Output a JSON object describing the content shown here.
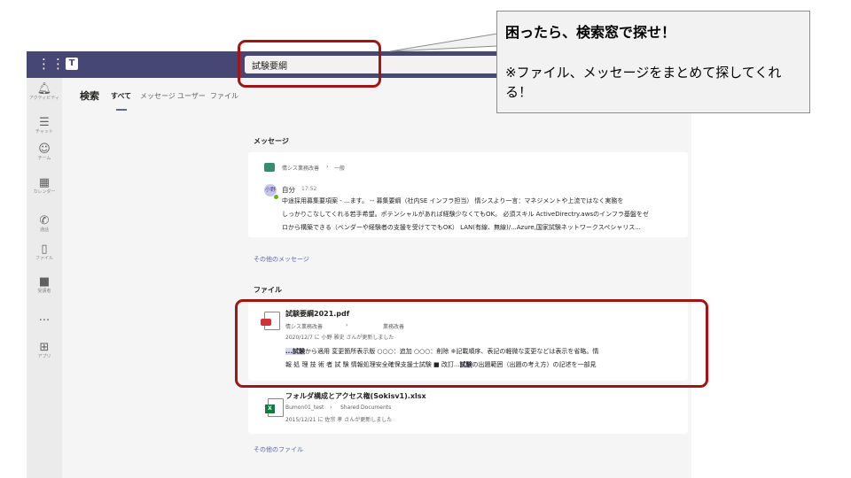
{
  "header": {
    "search_value": "試験要綱"
  },
  "rail": {
    "items": [
      {
        "label": "アクティビティ",
        "icon": "bell-icon"
      },
      {
        "label": "チャット",
        "icon": "chat-icon"
      },
      {
        "label": "チーム",
        "icon": "teams-icon"
      },
      {
        "label": "カレンダー",
        "icon": "calendar-icon"
      },
      {
        "label": "通話",
        "icon": "phone-icon"
      },
      {
        "label": "ファイル",
        "icon": "file-icon"
      },
      {
        "label": "受講者",
        "icon": "app-icon"
      },
      {
        "label": "アプリ",
        "icon": "apps-icon"
      }
    ],
    "more": "..."
  },
  "search_panel": {
    "title": "検索",
    "tabs": [
      "すべて",
      "メッセージ",
      "ユーザー",
      "ファイル"
    ]
  },
  "messages": {
    "section_title": "メッセージ",
    "channel": "情シス業務改善",
    "breadcrumb_sep": "›",
    "channel_sub": "一般",
    "avatar_initials": "小野",
    "sender": "自分",
    "time": "17:52",
    "lines": [
      "中途採用募集要項案 - ...ます。 -- 募集要綱（社内SE インフラ担当） 情シスより一言：マネジメントや上流ではなく実務を",
      "しっかりこなしてくれる若手希望。ポテンシャルがあれば経験少なくてもOK。 必須スキル ActiveDirectry.awsのインフラ基盤をゼ",
      "ロから構築できる（ベンダーや経験者の支援を受けてでもOK） LAN(有線、無線)/...Azure,国家試験ネットワークスペシャリス..."
    ],
    "more_link": "その他のメッセージ"
  },
  "files": {
    "section_title": "ファイル",
    "items": [
      {
        "name": "試験要綱2021.pdf",
        "path_a": "情シス業務改善",
        "path_sep": "›",
        "path_b": "業務改善",
        "updated": "2020/12/7 に 小野 雅史 さんが更新しました",
        "line1_hl1": "...試験",
        "line1_rest": "から適用 変更箇所表示版 ○○○：追加 ○○○：削除 ※記載順序、表記の軽微な変更などは表示を省略。情",
        "line2_pre": "報 処 理 技 術 者 試 験 情報処理安全確保支援士試験 ■ 改訂...",
        "line2_hl": "試験",
        "line2_post": "の出題範囲（出題の考え方）の記述を一部見"
      },
      {
        "name": "フォルダ構成とアクセス権(Sokisv1).xlsx",
        "path_a": "Bumon01_test",
        "path_sep": "›",
        "path_b": "Shared Documents",
        "updated": "2015/12/21 に 佐宗 孝 さんが更新しました",
        "badge": "X"
      }
    ],
    "more_link": "その他のファイル"
  },
  "callout": {
    "headline": "困ったら、検索窓で探せ！",
    "body": "※ファイル、メッセージをまとめて探してくれる！"
  }
}
